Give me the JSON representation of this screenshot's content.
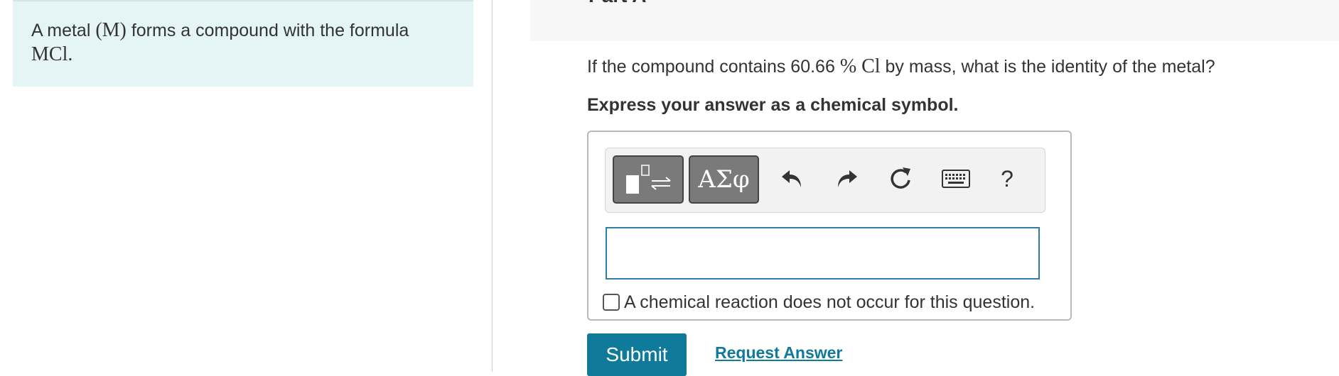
{
  "intro": {
    "text_1": "A metal ",
    "symbol_metal": "(M)",
    "text_2": " forms a compound with the formula",
    "formula": "MCl."
  },
  "part": {
    "title": "Part A"
  },
  "question": {
    "text_1": "If the compound contains 60.66 ",
    "percent": "%",
    "element": "Cl",
    "text_2": " by mass, what is the identity of the metal?"
  },
  "instruction": "Express your answer as a chemical symbol.",
  "toolbar": {
    "greek_label": "ΑΣφ",
    "help_label": "?",
    "icons": [
      "templates-icon",
      "undo-icon",
      "redo-icon",
      "reset-icon",
      "keyboard-icon",
      "help-icon"
    ]
  },
  "answer": {
    "value": "",
    "no_reaction_label": "A chemical reaction does not occur for this question.",
    "no_reaction_checked": false
  },
  "actions": {
    "submit_label": "Submit",
    "request_answer_label": "Request Answer"
  },
  "colors": {
    "accent": "#0f7a99",
    "intro_bg": "#e5f5f6",
    "input_border": "#2c7ea8"
  }
}
